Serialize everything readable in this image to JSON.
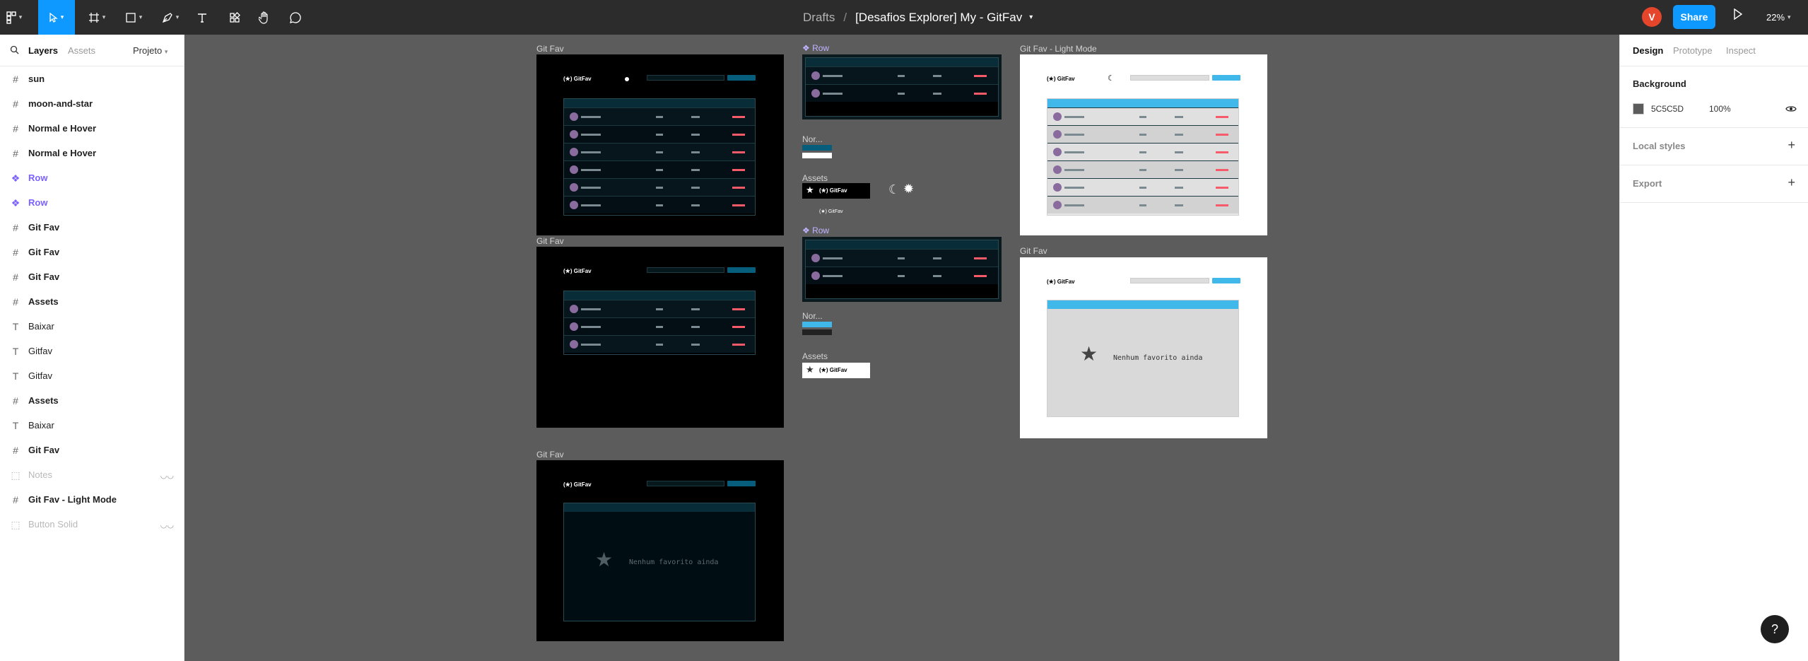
{
  "toolbar": {
    "file": {
      "drafts": "Drafts",
      "separator": "/",
      "name": "[Desafios Explorer] My - GitFav"
    },
    "avatar_initial": "V",
    "share_label": "Share",
    "zoom": "22%"
  },
  "left_panel": {
    "tabs": {
      "layers": "Layers",
      "assets": "Assets",
      "page": "Projeto"
    },
    "layers": [
      {
        "label": "sun",
        "kind": "frame"
      },
      {
        "label": "moon-and-star",
        "kind": "frame"
      },
      {
        "label": "Normal e Hover",
        "kind": "frame"
      },
      {
        "label": "Normal e Hover",
        "kind": "frame"
      },
      {
        "label": "Row",
        "kind": "component"
      },
      {
        "label": "Row",
        "kind": "component"
      },
      {
        "label": "Git Fav",
        "kind": "frame"
      },
      {
        "label": "Git Fav",
        "kind": "frame"
      },
      {
        "label": "Git Fav",
        "kind": "frame"
      },
      {
        "label": "Assets",
        "kind": "frame"
      },
      {
        "label": "Baixar",
        "kind": "text"
      },
      {
        "label": "Gitfav",
        "kind": "text"
      },
      {
        "label": "Gitfav",
        "kind": "text"
      },
      {
        "label": "Assets",
        "kind": "frame"
      },
      {
        "label": "Baixar",
        "kind": "text"
      },
      {
        "label": "Git Fav",
        "kind": "frame"
      },
      {
        "label": "Notes",
        "kind": "hidden"
      },
      {
        "label": "Git Fav - Light Mode",
        "kind": "frame"
      },
      {
        "label": "Button Solid",
        "kind": "hidden"
      }
    ]
  },
  "canvas": {
    "labels": {
      "gitfav_1": "Git Fav",
      "gitfav_2": "Git Fav",
      "gitfav_3": "Git Fav",
      "gitfav_light": "Git Fav - Light Mode",
      "gitfav_light_empty": "Git Fav",
      "row_1": "Row",
      "row_2": "Row",
      "nor_1": "Nor...",
      "nor_2": "Nor...",
      "assets_1": "Assets",
      "assets_2": "Assets"
    },
    "mock": {
      "logo": "(★) GitFav",
      "empty_message": "Nenhum favorito ainda"
    }
  },
  "right_panel": {
    "tabs": {
      "design": "Design",
      "prototype": "Prototype",
      "inspect": "Inspect"
    },
    "background_title": "Background",
    "background_hex": "5C5C5D",
    "background_opacity": "100%",
    "local_styles": "Local styles",
    "export": "Export"
  },
  "colors": {
    "accent": "#0d99ff",
    "canvas": "#5c5c5d",
    "component": "#7b61ff",
    "remove": "#f75a68"
  }
}
